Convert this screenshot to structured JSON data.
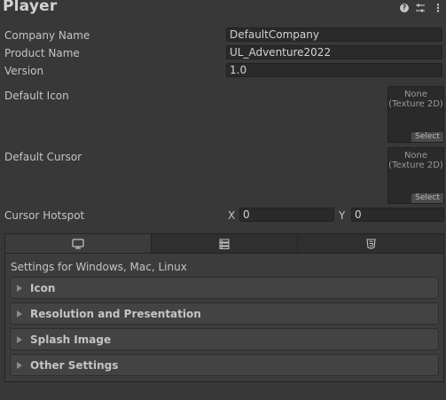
{
  "header": {
    "title": "Player",
    "help_icon": "help-icon",
    "presets_icon": "presets-icon",
    "more_icon": "more-vertical-icon",
    "help_glyph": "?",
    "more_glyph": "⋮"
  },
  "fields": {
    "company_name": {
      "label": "Company Name",
      "value": "DefaultCompany"
    },
    "product_name": {
      "label": "Product Name",
      "value": "UL_Adventure2022"
    },
    "version": {
      "label": "Version",
      "value": "1.0"
    }
  },
  "default_icon": {
    "label": "Default Icon",
    "none_line1": "None",
    "none_line2": "(Texture 2D)",
    "select_label": "Select"
  },
  "default_cursor": {
    "label": "Default Cursor",
    "none_line1": "None",
    "none_line2": "(Texture 2D)",
    "select_label": "Select"
  },
  "cursor_hotspot": {
    "label": "Cursor Hotspot",
    "x_label": "X",
    "x_value": "0",
    "y_label": "Y",
    "y_value": "0"
  },
  "platform_tabs": [
    {
      "icon": "monitor-icon",
      "active": true
    },
    {
      "icon": "server-icon",
      "active": false
    },
    {
      "icon": "html5-icon",
      "active": false
    }
  ],
  "panel": {
    "caption": "Settings for Windows, Mac, Linux",
    "sections": [
      {
        "label": "Icon"
      },
      {
        "label": "Resolution and Presentation"
      },
      {
        "label": "Splash Image"
      },
      {
        "label": "Other Settings"
      }
    ]
  },
  "colors": {
    "background": "#383838",
    "panel": "#3c3c3c",
    "field": "#2a2a2a",
    "text": "#c4c4c4"
  }
}
